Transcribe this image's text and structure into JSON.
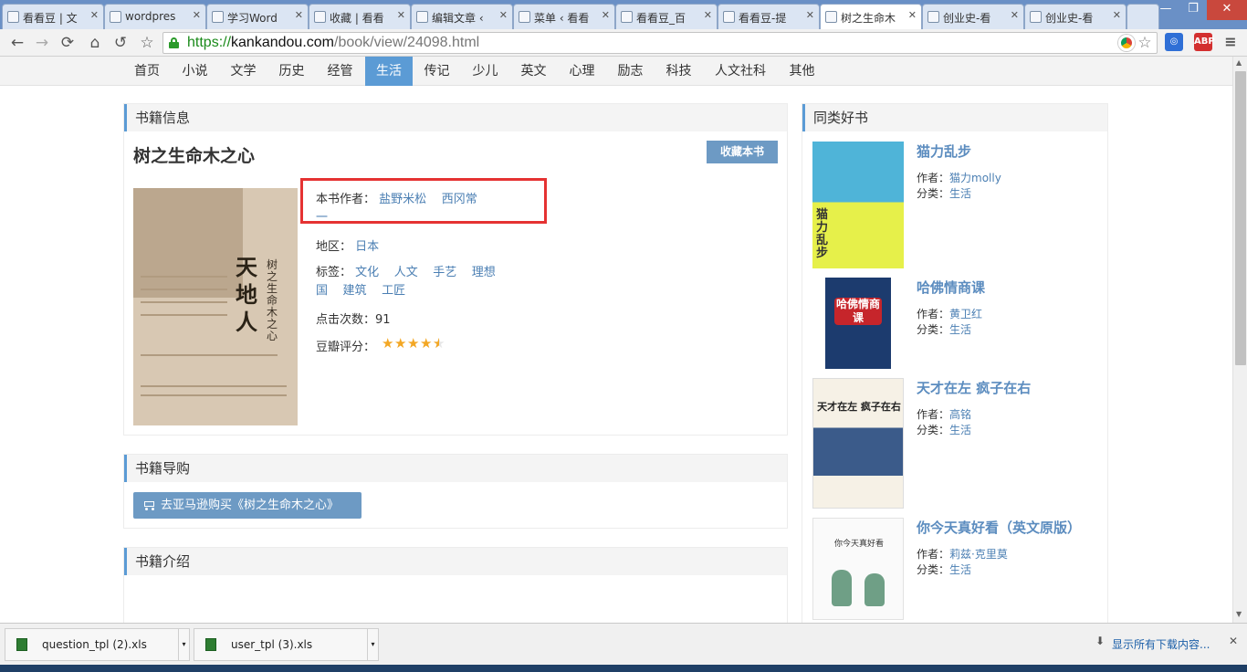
{
  "browser": {
    "tabs": [
      {
        "label": "看看豆 | 文",
        "icon": "page-icon"
      },
      {
        "label": "wordpres",
        "icon": "paw-icon"
      },
      {
        "label": "学习Word",
        "icon": "wordpress-icon"
      },
      {
        "label": "收藏 | 看看",
        "icon": "page-icon"
      },
      {
        "label": "编辑文章 ‹",
        "icon": "page-icon"
      },
      {
        "label": "菜单 ‹ 看看",
        "icon": "page-icon"
      },
      {
        "label": "看看豆_百",
        "icon": "paw-icon"
      },
      {
        "label": "看看豆-提",
        "icon": "site-icon"
      },
      {
        "label": "树之生命木",
        "icon": "site-icon"
      },
      {
        "label": "创业史-看",
        "icon": "site-icon"
      },
      {
        "label": "创业史-看",
        "icon": "site-icon"
      }
    ],
    "active_tab": 8,
    "url": {
      "scheme": "https://",
      "host": "kankandou.com",
      "path": "/book/view/24098.html"
    },
    "extension_abp": "ABP",
    "window_buttons": {
      "minimize": "—",
      "maximize": "❐",
      "close": "✕"
    }
  },
  "site_nav": {
    "items": [
      "首页",
      "小说",
      "文学",
      "历史",
      "经管",
      "生活",
      "传记",
      "少儿",
      "英文",
      "心理",
      "励志",
      "科技",
      "人文社科",
      "其他"
    ],
    "active": "生活"
  },
  "book": {
    "section_title": "书籍信息",
    "title": "树之生命木之心",
    "favorite_button": "收藏本书",
    "cover_big_text": "天地人",
    "cover_sub_text": "树之生命木之心",
    "author_label": "本书作者：",
    "authors": [
      "盐野米松",
      "西冈常",
      "一"
    ],
    "region_label": "地区：",
    "region": "日本",
    "tags_label": "标签：",
    "tags": [
      "文化",
      "人文",
      "手艺",
      "理想",
      "国",
      "建筑",
      "工匠"
    ],
    "clicks_label": "点击次数：",
    "clicks": "91",
    "rating_label": "豆瓣评分：",
    "rating_stars": 4.5
  },
  "purchase": {
    "section_title": "书籍导购",
    "button": "去亚马逊购买《树之生命木之心》"
  },
  "intro": {
    "section_title": "书籍介绍"
  },
  "sidebar": {
    "title": "同类好书",
    "author_label": "作者：",
    "category_label": "分类：",
    "books": [
      {
        "title": "猫力乱步",
        "author": "猫力molly",
        "category": "生活",
        "cover_text": "猫力乱步"
      },
      {
        "title": "哈佛情商课",
        "author": "黄卫红",
        "category": "生活",
        "cover_text": "哈佛情商课"
      },
      {
        "title": "天才在左 疯子在右",
        "author": "高铭",
        "category": "生活",
        "cover_text": "天才在左 疯子在右"
      },
      {
        "title": "你今天真好看（英文原版）",
        "author": "莉兹·克里莫",
        "category": "生活",
        "cover_text": "你今天真好看"
      }
    ]
  },
  "downloads": {
    "items": [
      "question_tpl (2).xls",
      "user_tpl (3).xls"
    ],
    "show_all": "显示所有下载内容..."
  },
  "colors": {
    "accent": "#5b9bd5",
    "link": "#4b7fb3",
    "button": "#6d9ac4",
    "highlight_border": "#e53232",
    "star": "#f3a724"
  }
}
